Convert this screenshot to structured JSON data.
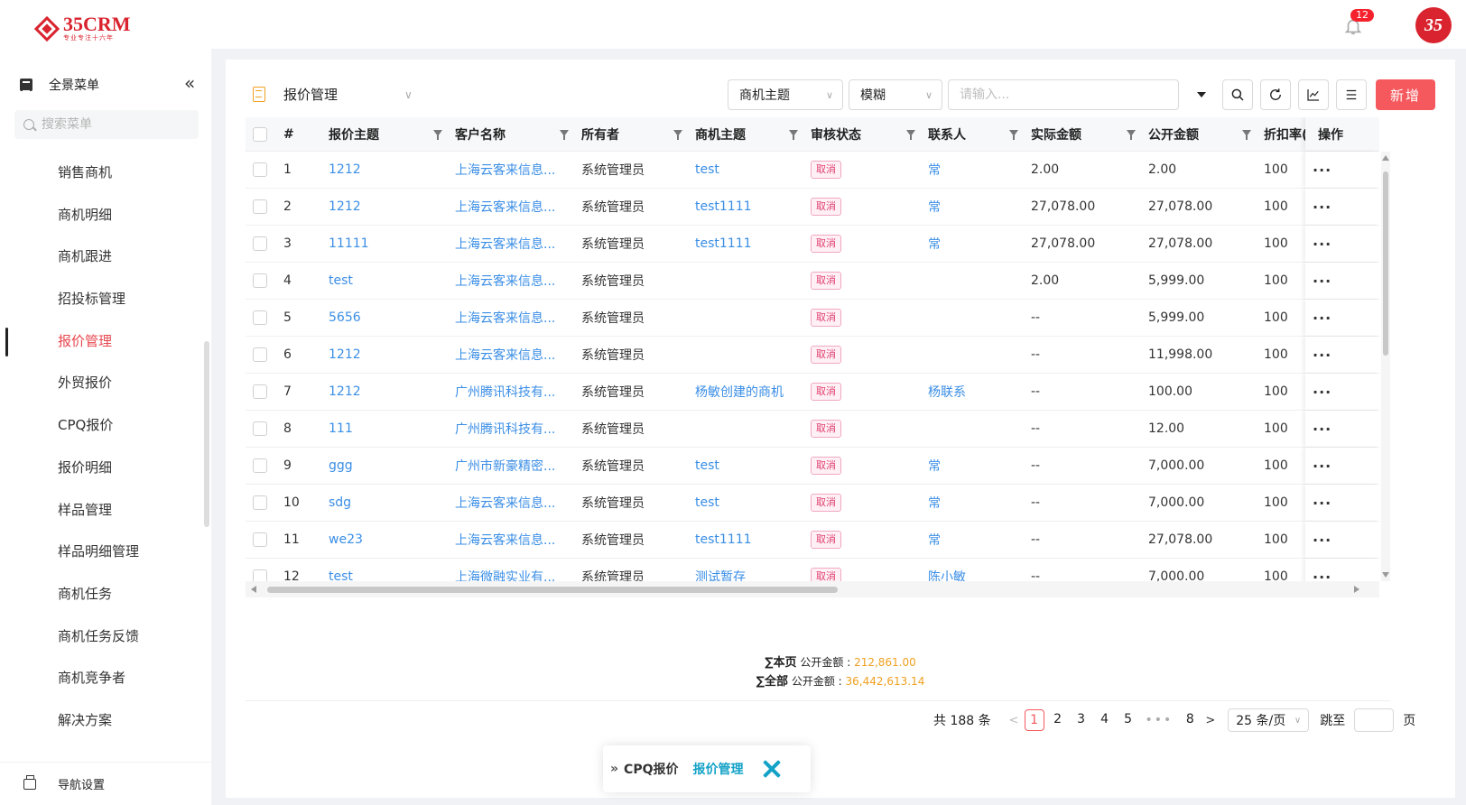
{
  "header": {
    "logo_name": "35CRM",
    "logo_slogan": "专业专注十六年",
    "notification_count": "12",
    "avatar_text": "35"
  },
  "sidebar": {
    "title": "全景菜单",
    "collapse_icon": "double-chevron-left-icon",
    "search_placeholder": "搜索菜单",
    "items": [
      {
        "label": "销售商机"
      },
      {
        "label": "商机明细"
      },
      {
        "label": "商机跟进"
      },
      {
        "label": "招投标管理"
      },
      {
        "label": "报价管理",
        "active": true
      },
      {
        "label": "外贸报价"
      },
      {
        "label": "CPQ报价"
      },
      {
        "label": "报价明细"
      },
      {
        "label": "样品管理"
      },
      {
        "label": "样品明细管理"
      },
      {
        "label": "商机任务"
      },
      {
        "label": "商机任务反馈"
      },
      {
        "label": "商机竞争者"
      },
      {
        "label": "解决方案"
      }
    ],
    "nav_settings": "导航设置"
  },
  "page": {
    "title": "报价管理"
  },
  "toolbar": {
    "field_select": "商机主题",
    "mode_select": "模糊",
    "search_placeholder": "请输入...",
    "new_button": "新增",
    "accent_color": "#f5595e"
  },
  "table": {
    "columns": [
      "#",
      "报价主题",
      "客户名称",
      "所有者",
      "商机主题",
      "审核状态",
      "联系人",
      "实际金额",
      "公开金额",
      "折扣率(",
      "操作"
    ],
    "rows": [
      [
        "1",
        "1212",
        "上海云客来信息...",
        "系统管理员",
        "test",
        "取消",
        "常",
        "2.00",
        "2.00",
        "100"
      ],
      [
        "2",
        "1212",
        "上海云客来信息...",
        "系统管理员",
        "test1111",
        "取消",
        "常",
        "27,078.00",
        "27,078.00",
        "100"
      ],
      [
        "3",
        "11111",
        "上海云客来信息...",
        "系统管理员",
        "test1111",
        "取消",
        "常",
        "27,078.00",
        "27,078.00",
        "100"
      ],
      [
        "4",
        "test",
        "上海云客来信息...",
        "系统管理员",
        "",
        "取消",
        "",
        "2.00",
        "5,999.00",
        "100"
      ],
      [
        "5",
        "5656",
        "上海云客来信息...",
        "系统管理员",
        "",
        "取消",
        "",
        "--",
        "5,999.00",
        "100"
      ],
      [
        "6",
        "1212",
        "上海云客来信息...",
        "系统管理员",
        "",
        "取消",
        "",
        "--",
        "11,998.00",
        "100"
      ],
      [
        "7",
        "1212",
        "广州腾讯科技有...",
        "系统管理员",
        "杨敏创建的商机",
        "取消",
        "杨联系",
        "--",
        "100.00",
        "100"
      ],
      [
        "8",
        "111",
        "广州腾讯科技有...",
        "系统管理员",
        "",
        "取消",
        "",
        "--",
        "12.00",
        "100"
      ],
      [
        "9",
        "ggg",
        "广州市新豪精密...",
        "系统管理员",
        "test",
        "取消",
        "常",
        "--",
        "7,000.00",
        "100"
      ],
      [
        "10",
        "sdg",
        "上海云客来信息...",
        "系统管理员",
        "test",
        "取消",
        "常",
        "--",
        "7,000.00",
        "100"
      ],
      [
        "11",
        "we23",
        "上海云客来信息...",
        "系统管理员",
        "test1111",
        "取消",
        "常",
        "--",
        "27,078.00",
        "100"
      ],
      [
        "12",
        "test",
        "上海微融实业有...",
        "系统管理员",
        "测试暂存",
        "取消",
        "陈小敏",
        "--",
        "7,000.00",
        "100"
      ]
    ],
    "row_action": "···"
  },
  "summary": {
    "page_label": "∑本页",
    "all_label": "∑全部",
    "field_label": "公开金额 :",
    "page_amount": "212,861.00",
    "all_amount": "36,442,613.14"
  },
  "pagination": {
    "total": "共 188 条",
    "pages": [
      "1",
      "2",
      "3",
      "4",
      "5"
    ],
    "ellipsis": "•••",
    "last_page": "8",
    "current": "1",
    "page_size": "25 条/页",
    "jump_label": "跳至",
    "page_suffix": "页"
  },
  "float_breadcrumb": {
    "parent": "CPQ报价",
    "current": "报价管理"
  }
}
